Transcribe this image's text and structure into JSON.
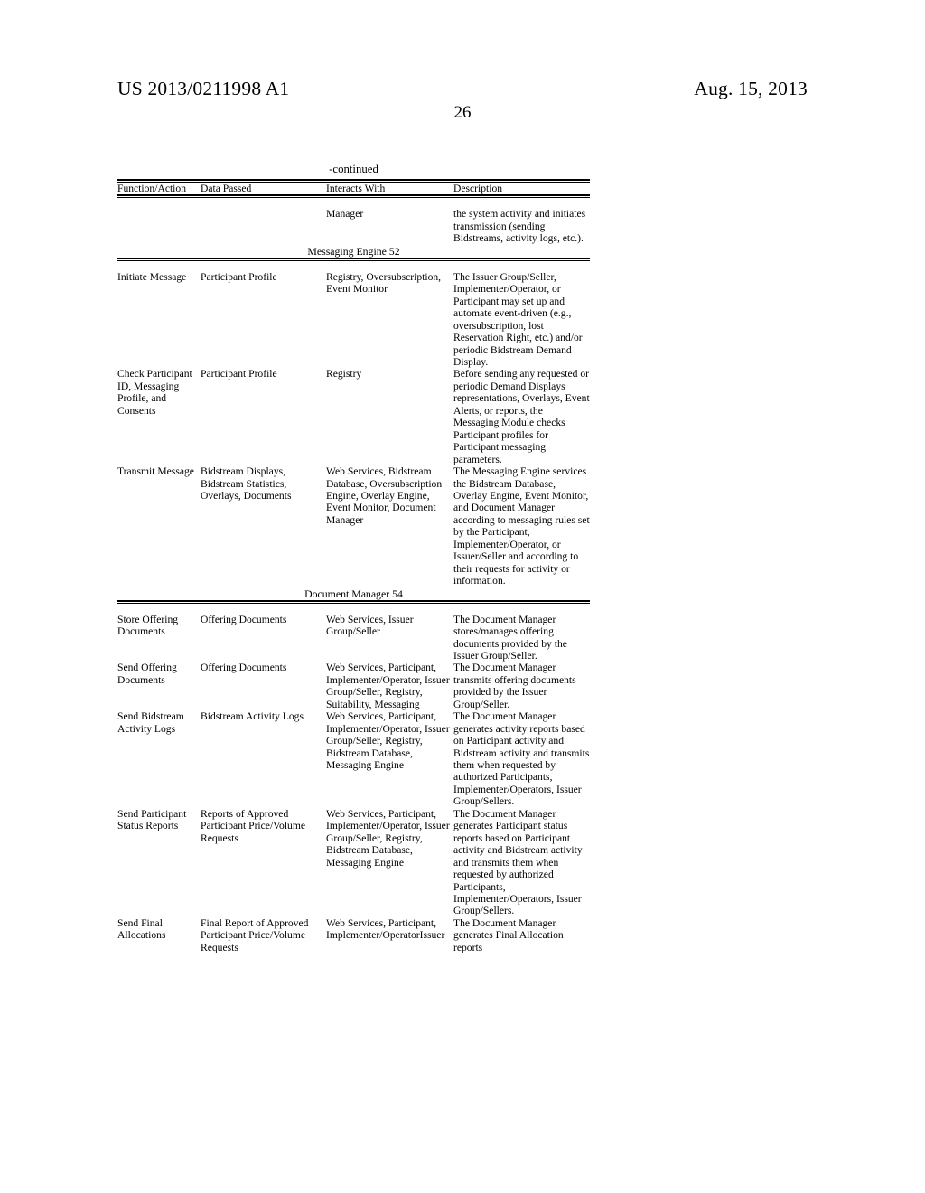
{
  "header": {
    "publication_number": "US 2013/0211998 A1",
    "publication_date": "Aug. 15, 2013",
    "page_number": "26"
  },
  "table": {
    "continued_label": "-continued",
    "columns": [
      "Function/Action",
      "Data Passed",
      "Interacts With",
      "Description"
    ],
    "carryover_row": {
      "function_action": "",
      "data_passed": "",
      "interacts_with": "Manager",
      "description": "the system activity and initiates transmission (sending Bidstreams, activity logs, etc.)."
    },
    "sections": [
      {
        "caption": "Messaging Engine 52",
        "rows": [
          {
            "function_action": "Initiate Message",
            "data_passed": "Participant Profile",
            "interacts_with": "Registry, Oversubscription, Event Monitor",
            "description": "The Issuer Group/Seller, Implementer/Operator, or Participant may set up and automate event-driven (e.g., oversubscription, lost Reservation Right, etc.) and/or periodic Bidstream Demand Display."
          },
          {
            "function_action": "Check Participant ID, Messaging Profile, and Consents",
            "data_passed": "Participant Profile",
            "interacts_with": "Registry",
            "description": "Before sending any requested or periodic Demand Displays representations, Overlays, Event Alerts, or reports, the Messaging Module checks Participant profiles for Participant messaging parameters."
          },
          {
            "function_action": "Transmit Message",
            "data_passed": "Bidstream Displays, Bidstream Statistics, Overlays, Documents",
            "interacts_with": "Web Services, Bidstream Database, Oversubscription Engine, Overlay Engine, Event Monitor, Document Manager",
            "description": "The Messaging Engine services the Bidstream Database, Overlay Engine, Event Monitor, and Document Manager according to messaging rules set by the Participant, Implementer/Operator, or Issuer/Seller and according to their requests for activity or information."
          }
        ]
      },
      {
        "caption": "Document Manager 54",
        "rows": [
          {
            "function_action": "Store Offering Documents",
            "data_passed": "Offering Documents",
            "interacts_with": "Web Services, Issuer Group/Seller",
            "description": "The Document Manager stores/manages offering documents provided by the Issuer Group/Seller."
          },
          {
            "function_action": "Send Offering Documents",
            "data_passed": "Offering Documents",
            "interacts_with": "Web Services, Participant, Implementer/Operator, Issuer Group/Seller, Registry, Suitability, Messaging",
            "description": "The Document Manager transmits offering documents provided by the Issuer Group/Seller."
          },
          {
            "function_action": "Send Bidstream Activity Logs",
            "data_passed": "Bidstream Activity Logs",
            "interacts_with": "Web Services, Participant, Implementer/Operator, Issuer Group/Seller, Registry, Bidstream Database, Messaging Engine",
            "description": "The Document Manager generates activity reports based on Participant activity and Bidstream activity and transmits them when requested by authorized Participants, Implementer/Operators, Issuer Group/Sellers."
          },
          {
            "function_action": "Send Participant Status Reports",
            "data_passed": "Reports of Approved Participant Price/Volume Requests",
            "interacts_with": "Web Services, Participant, Implementer/Operator, Issuer Group/Seller, Registry, Bidstream Database, Messaging Engine",
            "description": "The Document Manager generates Participant status reports based on Participant activity and Bidstream activity and transmits them when requested by authorized Participants, Implementer/Operators, Issuer Group/Sellers."
          },
          {
            "function_action": "Send Final Allocations",
            "data_passed": "Final Report of Approved Participant Price/Volume Requests",
            "interacts_with": "Web Services, Participant, Implementer/OperatorIssuer",
            "description": "The Document Manager generates Final Allocation reports"
          }
        ]
      }
    ]
  }
}
